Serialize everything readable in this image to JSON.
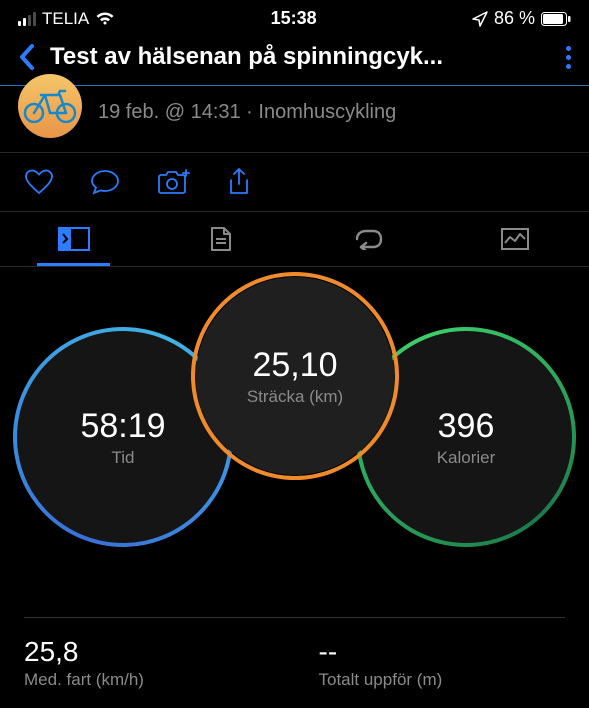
{
  "statusBar": {
    "carrier": "TELIA",
    "time": "15:38",
    "batteryPct": "86 %"
  },
  "header": {
    "title": "Test av hälsenan på spinningcyk..."
  },
  "activity": {
    "meta": "19 feb. @ 14:31 · Inomhuscykling"
  },
  "dials": {
    "distance": {
      "value": "25,10",
      "label": "Sträcka (km)"
    },
    "time": {
      "value": "58:19",
      "label": "Tid"
    },
    "calories": {
      "value": "396",
      "label": "Kalorier"
    }
  },
  "stats": {
    "avgSpeed": {
      "value": "25,8",
      "label": "Med. fart (km/h)"
    },
    "elevation": {
      "value": "--",
      "label": "Totalt uppför (m)"
    }
  }
}
